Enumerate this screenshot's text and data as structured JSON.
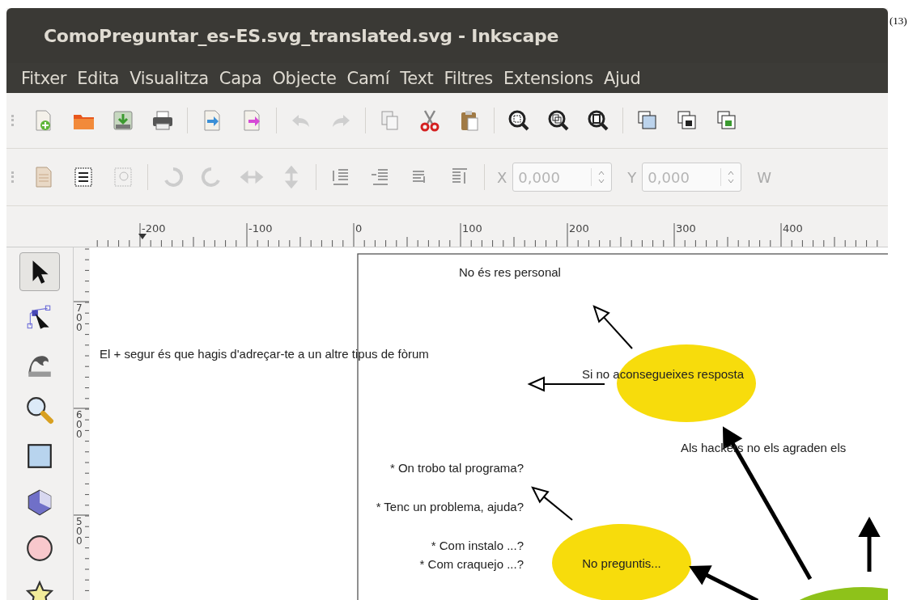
{
  "window": {
    "title": "ComoPreguntar_es-ES.svg_translated.svg - Inkscape"
  },
  "figure_number": "(13)",
  "menu": [
    "Fitxer",
    "Edita",
    "Visualitza",
    "Capa",
    "Objecte",
    "Camí",
    "Text",
    "Filtres",
    "Extensions",
    "Ajud"
  ],
  "controls_bar": {
    "fields": [
      {
        "label": "X",
        "value": "0,000",
        "disabled": true
      },
      {
        "label": "Y",
        "value": "0,000",
        "disabled": true
      }
    ],
    "cut_label": "W"
  },
  "rulers": {
    "horizontal": [
      "-200",
      "-100",
      "0",
      "100",
      "200",
      "300",
      "400"
    ],
    "vertical": [
      "700",
      "600",
      "500"
    ]
  },
  "tools": [
    {
      "kind": "selector",
      "selected": true
    },
    {
      "kind": "node",
      "selected": false
    },
    {
      "kind": "tweak",
      "selected": false
    },
    {
      "kind": "zoom",
      "selected": false
    },
    {
      "kind": "rectangle",
      "selected": false
    },
    {
      "kind": "box3d",
      "selected": false
    },
    {
      "kind": "ellipse",
      "selected": false
    },
    {
      "kind": "star",
      "selected": false
    }
  ],
  "diagram": {
    "bubbles": [
      {
        "color": "#f7dc0c",
        "label": "No preguntis..."
      },
      {
        "color": "#f7dc0c"
      },
      {
        "color": "#8ec21a"
      }
    ],
    "labels": [
      "No és res personal",
      "El + segur és que hagis d'adreçar-te a un altre tipus de fòrum",
      "Si no aconsegueixes resposta",
      "Als hackers no els agraden els",
      "* On trobo tal programa?",
      "* Tenc un problema, ajuda?",
      "* Com instalo ...?",
      "* Com craquejo ...?"
    ]
  }
}
